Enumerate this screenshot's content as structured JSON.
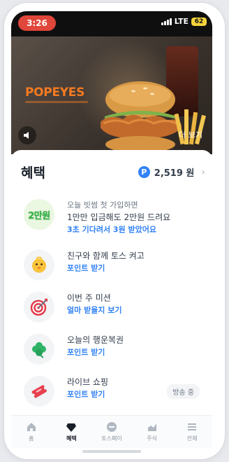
{
  "status": {
    "time": "3:26",
    "network": "LTE",
    "battery": "62"
  },
  "banner": {
    "brand": "POPEYES",
    "more_label": "더 보기"
  },
  "benefits": {
    "title": "혜택",
    "points_label": "2,519 원",
    "items": [
      {
        "title": "오늘 빗썸 첫 가입하면",
        "line2": "1만만 입금해도 2만원 드려요",
        "sub": "3초 기다려서 3원 받았어요",
        "badge": "2만원"
      },
      {
        "title": "친구와 함께 토스 켜고",
        "sub": "포인트 받기"
      },
      {
        "title": "이번 주 미션",
        "sub": "얼마 받을지 보기"
      },
      {
        "title": "오늘의 행운복권",
        "sub": "포인트 받기"
      },
      {
        "title": "라이브 쇼핑",
        "sub": "포인트 받기",
        "status": "방송 중"
      }
    ]
  },
  "tabs": [
    {
      "label": "홈",
      "icon": "home-icon"
    },
    {
      "label": "혜택",
      "icon": "gem-icon"
    },
    {
      "label": "토스페이",
      "icon": "pay-icon"
    },
    {
      "label": "주식",
      "icon": "chart-icon"
    },
    {
      "label": "전체",
      "icon": "menu-icon"
    }
  ],
  "colors": {
    "accent": "#3182f6",
    "badge_green": "#3bb54a",
    "time_pill": "#e0463a",
    "brand": "#f47a20"
  }
}
